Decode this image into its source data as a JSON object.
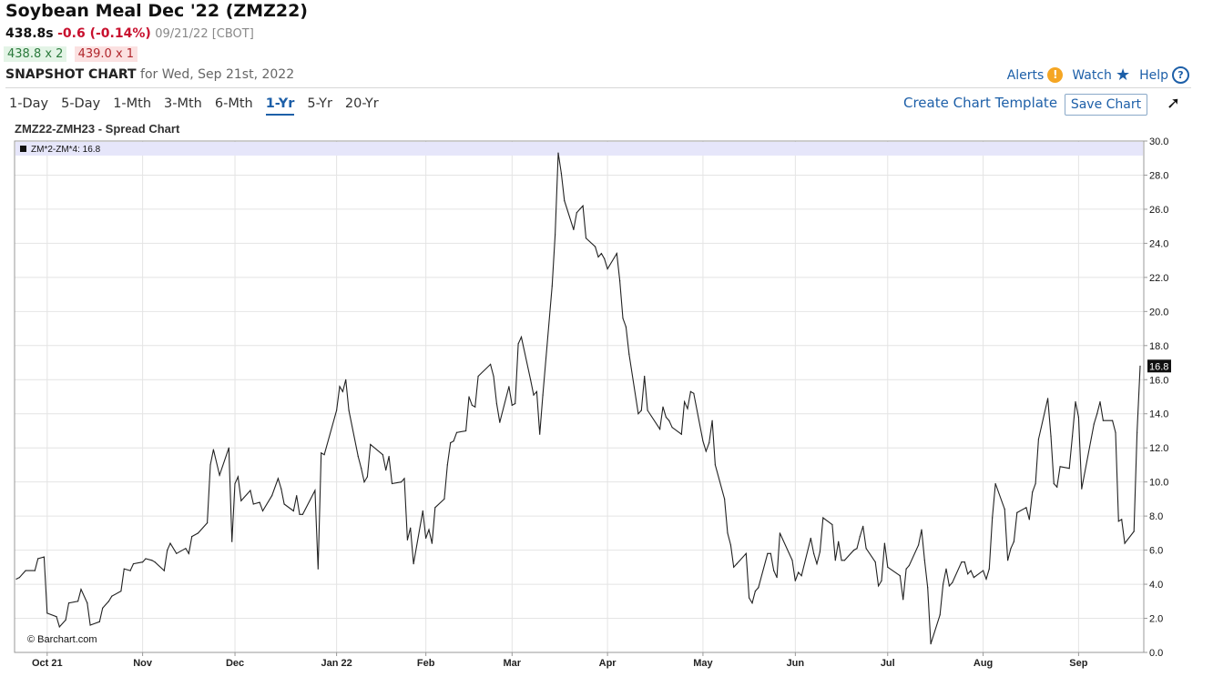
{
  "header": {
    "title": "Soybean Meal Dec '22 (ZMZ22)",
    "last": "438.8s",
    "change": "-0.6 (-0.14%)",
    "date_exchange": "09/21/22 [CBOT]",
    "bid": "438.8 x 2",
    "ask": "439.0 x 1",
    "snapshot_label": "SNAPSHOT CHART",
    "snapshot_date": "for Wed, Sep 21st, 2022"
  },
  "links": {
    "alerts": "Alerts",
    "watch": "Watch",
    "help": "Help"
  },
  "icons": {
    "alerts": "exclamation-circle-icon",
    "watch": "star-icon",
    "help": "question-circle-icon",
    "expand": "expand-arrow-icon"
  },
  "tabs": [
    {
      "label": "1-Day",
      "active": false
    },
    {
      "label": "5-Day",
      "active": false
    },
    {
      "label": "1-Mth",
      "active": false
    },
    {
      "label": "3-Mth",
      "active": false
    },
    {
      "label": "6-Mth",
      "active": false
    },
    {
      "label": "1-Yr",
      "active": true
    },
    {
      "label": "5-Yr",
      "active": false
    },
    {
      "label": "20-Yr",
      "active": false
    }
  ],
  "actions": {
    "create_template": "Create Chart Template",
    "save_chart": "Save Chart"
  },
  "colors": {
    "accent": "#1d5fa8",
    "down": "#c8102e",
    "line": "#222222",
    "legend_band": "#e6e6fa",
    "grid": "#e4e4e4"
  },
  "chart_data": {
    "type": "line",
    "title": "ZMZ22-ZMH23 - Spread Chart",
    "legend": "ZM*2-ZM*4: 16.8",
    "last_value": 16.8,
    "last_label": "16.8",
    "watermark": "© Barchart.com",
    "ylim": [
      0,
      30
    ],
    "yticks": [
      "0.0",
      "2.0",
      "4.0",
      "6.0",
      "8.0",
      "10.0",
      "12.0",
      "14.0",
      "16.0",
      "18.0",
      "20.0",
      "22.0",
      "24.0",
      "26.0",
      "28.0",
      "30.0"
    ],
    "xlim": [
      "2021-09-21",
      "2022-09-21"
    ],
    "x_ticks": [
      {
        "label": "Oct 21",
        "date": "2021-10-01"
      },
      {
        "label": "Nov",
        "date": "2021-11-01"
      },
      {
        "label": "Dec",
        "date": "2021-12-01"
      },
      {
        "label": "Jan 22",
        "date": "2022-01-03"
      },
      {
        "label": "Feb",
        "date": "2022-02-01"
      },
      {
        "label": "Mar",
        "date": "2022-03-01"
      },
      {
        "label": "Apr",
        "date": "2022-04-01"
      },
      {
        "label": "May",
        "date": "2022-05-02"
      },
      {
        "label": "Jun",
        "date": "2022-06-01"
      },
      {
        "label": "Jul",
        "date": "2022-07-01"
      },
      {
        "label": "Aug",
        "date": "2022-08-01"
      },
      {
        "label": "Sep",
        "date": "2022-09-01"
      }
    ],
    "series": [
      {
        "points": [
          [
            "2021-09-21",
            4.3
          ],
          [
            "2021-09-22",
            4.4
          ],
          [
            "2021-09-24",
            4.8
          ],
          [
            "2021-09-27",
            4.8
          ],
          [
            "2021-09-28",
            5.5
          ],
          [
            "2021-09-30",
            5.6
          ],
          [
            "2021-10-01",
            2.3
          ],
          [
            "2021-10-04",
            2.1
          ],
          [
            "2021-10-05",
            1.5
          ],
          [
            "2021-10-07",
            1.9
          ],
          [
            "2021-10-08",
            2.9
          ],
          [
            "2021-10-11",
            3.0
          ],
          [
            "2021-10-12",
            3.7
          ],
          [
            "2021-10-14",
            2.9
          ],
          [
            "2021-10-15",
            1.6
          ],
          [
            "2021-10-18",
            1.8
          ],
          [
            "2021-10-19",
            2.6
          ],
          [
            "2021-10-21",
            3.0
          ],
          [
            "2021-10-22",
            3.3
          ],
          [
            "2021-10-25",
            3.6
          ],
          [
            "2021-10-26",
            4.9
          ],
          [
            "2021-10-28",
            4.8
          ],
          [
            "2021-10-29",
            5.2
          ],
          [
            "2021-11-01",
            5.3
          ],
          [
            "2021-11-02",
            5.5
          ],
          [
            "2021-11-04",
            5.4
          ],
          [
            "2021-11-05",
            5.3
          ],
          [
            "2021-11-08",
            4.8
          ],
          [
            "2021-11-09",
            6.0
          ],
          [
            "2021-11-10",
            6.4
          ],
          [
            "2021-11-12",
            5.8
          ],
          [
            "2021-11-15",
            6.1
          ],
          [
            "2021-11-16",
            5.8
          ],
          [
            "2021-11-17",
            6.8
          ],
          [
            "2021-11-19",
            7.0
          ],
          [
            "2021-11-22",
            7.6
          ],
          [
            "2021-11-23",
            11.0
          ],
          [
            "2021-11-24",
            11.9
          ],
          [
            "2021-11-26",
            10.4
          ],
          [
            "2021-11-29",
            12.0
          ],
          [
            "2021-11-30",
            6.5
          ],
          [
            "2021-12-01",
            9.9
          ],
          [
            "2021-12-02",
            10.3
          ],
          [
            "2021-12-03",
            8.9
          ],
          [
            "2021-12-06",
            9.5
          ],
          [
            "2021-12-07",
            8.7
          ],
          [
            "2021-12-09",
            8.8
          ],
          [
            "2021-12-10",
            8.3
          ],
          [
            "2021-12-13",
            9.2
          ],
          [
            "2021-12-15",
            10.2
          ],
          [
            "2021-12-16",
            9.6
          ],
          [
            "2021-12-17",
            8.7
          ],
          [
            "2021-12-20",
            8.3
          ],
          [
            "2021-12-21",
            9.2
          ],
          [
            "2021-12-22",
            8.1
          ],
          [
            "2021-12-23",
            8.1
          ],
          [
            "2021-12-27",
            9.5
          ],
          [
            "2021-12-28",
            4.9
          ],
          [
            "2021-12-29",
            11.7
          ],
          [
            "2021-12-30",
            11.6
          ],
          [
            "2022-01-03",
            14.2
          ],
          [
            "2022-01-04",
            15.6
          ],
          [
            "2022-01-05",
            15.3
          ],
          [
            "2022-01-06",
            16.0
          ],
          [
            "2022-01-07",
            14.2
          ],
          [
            "2022-01-10",
            11.5
          ],
          [
            "2022-01-11",
            10.8
          ],
          [
            "2022-01-12",
            10.0
          ],
          [
            "2022-01-13",
            10.3
          ],
          [
            "2022-01-14",
            12.2
          ],
          [
            "2022-01-18",
            11.6
          ],
          [
            "2022-01-19",
            10.7
          ],
          [
            "2022-01-20",
            11.5
          ],
          [
            "2022-01-21",
            9.9
          ],
          [
            "2022-01-24",
            10.0
          ],
          [
            "2022-01-25",
            10.2
          ],
          [
            "2022-01-26",
            6.6
          ],
          [
            "2022-01-27",
            7.3
          ],
          [
            "2022-01-28",
            5.2
          ],
          [
            "2022-01-31",
            8.3
          ],
          [
            "2022-02-01",
            6.7
          ],
          [
            "2022-02-02",
            7.2
          ],
          [
            "2022-02-03",
            6.4
          ],
          [
            "2022-02-04",
            8.5
          ],
          [
            "2022-02-07",
            9.0
          ],
          [
            "2022-02-08",
            11.0
          ],
          [
            "2022-02-09",
            12.3
          ],
          [
            "2022-02-10",
            12.4
          ],
          [
            "2022-02-11",
            12.9
          ],
          [
            "2022-02-14",
            13.0
          ],
          [
            "2022-02-15",
            15.0
          ],
          [
            "2022-02-16",
            14.5
          ],
          [
            "2022-02-17",
            14.4
          ],
          [
            "2022-02-18",
            16.2
          ],
          [
            "2022-02-22",
            16.9
          ],
          [
            "2022-02-23",
            16.2
          ],
          [
            "2022-02-24",
            14.6
          ],
          [
            "2022-02-25",
            13.5
          ],
          [
            "2022-02-28",
            15.6
          ],
          [
            "2022-03-01",
            14.5
          ],
          [
            "2022-03-02",
            14.6
          ],
          [
            "2022-03-03",
            18.1
          ],
          [
            "2022-03-04",
            18.5
          ],
          [
            "2022-03-07",
            16.0
          ],
          [
            "2022-03-08",
            15.1
          ],
          [
            "2022-03-09",
            15.3
          ],
          [
            "2022-03-10",
            12.8
          ],
          [
            "2022-03-11",
            15.1
          ],
          [
            "2022-03-14",
            21.5
          ],
          [
            "2022-03-15",
            24.5
          ],
          [
            "2022-03-16",
            29.3
          ],
          [
            "2022-03-17",
            28.1
          ],
          [
            "2022-03-18",
            26.5
          ],
          [
            "2022-03-21",
            24.8
          ],
          [
            "2022-03-22",
            25.8
          ],
          [
            "2022-03-23",
            26.0
          ],
          [
            "2022-03-24",
            26.2
          ],
          [
            "2022-03-25",
            24.3
          ],
          [
            "2022-03-28",
            23.8
          ],
          [
            "2022-03-29",
            23.2
          ],
          [
            "2022-03-30",
            23.4
          ],
          [
            "2022-03-31",
            23.1
          ],
          [
            "2022-04-01",
            22.5
          ],
          [
            "2022-04-04",
            23.4
          ],
          [
            "2022-04-05",
            21.8
          ],
          [
            "2022-04-06",
            19.6
          ],
          [
            "2022-04-07",
            19.1
          ],
          [
            "2022-04-08",
            17.5
          ],
          [
            "2022-04-11",
            14.0
          ],
          [
            "2022-04-12",
            14.2
          ],
          [
            "2022-04-13",
            16.2
          ],
          [
            "2022-04-14",
            14.2
          ],
          [
            "2022-04-18",
            13.1
          ],
          [
            "2022-04-19",
            14.4
          ],
          [
            "2022-04-20",
            13.8
          ],
          [
            "2022-04-21",
            13.6
          ],
          [
            "2022-04-22",
            13.2
          ],
          [
            "2022-04-25",
            12.8
          ],
          [
            "2022-04-26",
            14.7
          ],
          [
            "2022-04-27",
            14.3
          ],
          [
            "2022-04-28",
            15.3
          ],
          [
            "2022-04-29",
            15.2
          ],
          [
            "2022-05-02",
            12.4
          ],
          [
            "2022-05-03",
            11.8
          ],
          [
            "2022-05-04",
            12.3
          ],
          [
            "2022-05-05",
            13.6
          ],
          [
            "2022-05-06",
            11.0
          ],
          [
            "2022-05-09",
            9.0
          ],
          [
            "2022-05-10",
            7.0
          ],
          [
            "2022-05-11",
            6.3
          ],
          [
            "2022-05-12",
            5.0
          ],
          [
            "2022-05-13",
            5.2
          ],
          [
            "2022-05-16",
            5.8
          ],
          [
            "2022-05-17",
            3.2
          ],
          [
            "2022-05-18",
            2.9
          ],
          [
            "2022-05-19",
            3.6
          ],
          [
            "2022-05-20",
            3.8
          ],
          [
            "2022-05-23",
            5.8
          ],
          [
            "2022-05-24",
            5.8
          ],
          [
            "2022-05-25",
            4.8
          ],
          [
            "2022-05-26",
            4.4
          ],
          [
            "2022-05-27",
            7.0
          ],
          [
            "2022-05-31",
            5.4
          ],
          [
            "2022-06-01",
            4.2
          ],
          [
            "2022-06-02",
            4.7
          ],
          [
            "2022-06-03",
            4.5
          ],
          [
            "2022-06-06",
            6.7
          ],
          [
            "2022-06-07",
            5.8
          ],
          [
            "2022-06-08",
            5.2
          ],
          [
            "2022-06-09",
            5.9
          ],
          [
            "2022-06-10",
            7.9
          ],
          [
            "2022-06-13",
            7.5
          ],
          [
            "2022-06-14",
            5.4
          ],
          [
            "2022-06-15",
            6.5
          ],
          [
            "2022-06-16",
            5.4
          ],
          [
            "2022-06-17",
            5.4
          ],
          [
            "2022-06-20",
            6.0
          ],
          [
            "2022-06-21",
            6.1
          ],
          [
            "2022-06-22",
            6.8
          ],
          [
            "2022-06-23",
            7.4
          ],
          [
            "2022-06-24",
            6.1
          ],
          [
            "2022-06-27",
            5.3
          ],
          [
            "2022-06-28",
            3.9
          ],
          [
            "2022-06-29",
            4.2
          ],
          [
            "2022-06-30",
            6.4
          ],
          [
            "2022-07-01",
            5.0
          ],
          [
            "2022-07-05",
            4.5
          ],
          [
            "2022-07-06",
            3.1
          ],
          [
            "2022-07-07",
            4.9
          ],
          [
            "2022-07-08",
            5.1
          ],
          [
            "2022-07-11",
            6.3
          ],
          [
            "2022-07-12",
            7.2
          ],
          [
            "2022-07-13",
            5.4
          ],
          [
            "2022-07-14",
            3.8
          ],
          [
            "2022-07-15",
            0.5
          ],
          [
            "2022-07-18",
            2.2
          ],
          [
            "2022-07-19",
            4.0
          ],
          [
            "2022-07-20",
            4.9
          ],
          [
            "2022-07-21",
            3.9
          ],
          [
            "2022-07-22",
            4.1
          ],
          [
            "2022-07-25",
            5.3
          ],
          [
            "2022-07-26",
            5.3
          ],
          [
            "2022-07-27",
            4.6
          ],
          [
            "2022-07-28",
            4.8
          ],
          [
            "2022-07-29",
            4.4
          ],
          [
            "2022-08-01",
            4.8
          ],
          [
            "2022-08-02",
            4.3
          ],
          [
            "2022-08-03",
            4.9
          ],
          [
            "2022-08-04",
            7.9
          ],
          [
            "2022-08-05",
            9.9
          ],
          [
            "2022-08-08",
            8.4
          ],
          [
            "2022-08-09",
            5.4
          ],
          [
            "2022-08-10",
            6.1
          ],
          [
            "2022-08-11",
            6.5
          ],
          [
            "2022-08-12",
            8.2
          ],
          [
            "2022-08-15",
            8.5
          ],
          [
            "2022-08-16",
            7.8
          ],
          [
            "2022-08-17",
            9.4
          ],
          [
            "2022-08-18",
            9.9
          ],
          [
            "2022-08-19",
            12.5
          ],
          [
            "2022-08-22",
            14.9
          ],
          [
            "2022-08-23",
            12.7
          ],
          [
            "2022-08-24",
            9.9
          ],
          [
            "2022-08-25",
            9.7
          ],
          [
            "2022-08-26",
            10.9
          ],
          [
            "2022-08-29",
            10.8
          ],
          [
            "2022-08-30",
            12.7
          ],
          [
            "2022-08-31",
            14.7
          ],
          [
            "2022-09-01",
            13.8
          ],
          [
            "2022-09-02",
            9.6
          ],
          [
            "2022-09-06",
            13.4
          ],
          [
            "2022-09-07",
            14.0
          ],
          [
            "2022-09-08",
            14.7
          ],
          [
            "2022-09-09",
            13.6
          ],
          [
            "2022-09-12",
            13.6
          ],
          [
            "2022-09-13",
            12.9
          ],
          [
            "2022-09-14",
            7.7
          ],
          [
            "2022-09-15",
            7.8
          ],
          [
            "2022-09-16",
            6.4
          ],
          [
            "2022-09-19",
            7.1
          ],
          [
            "2022-09-20",
            12.9
          ],
          [
            "2022-09-21",
            16.8
          ]
        ]
      }
    ]
  }
}
